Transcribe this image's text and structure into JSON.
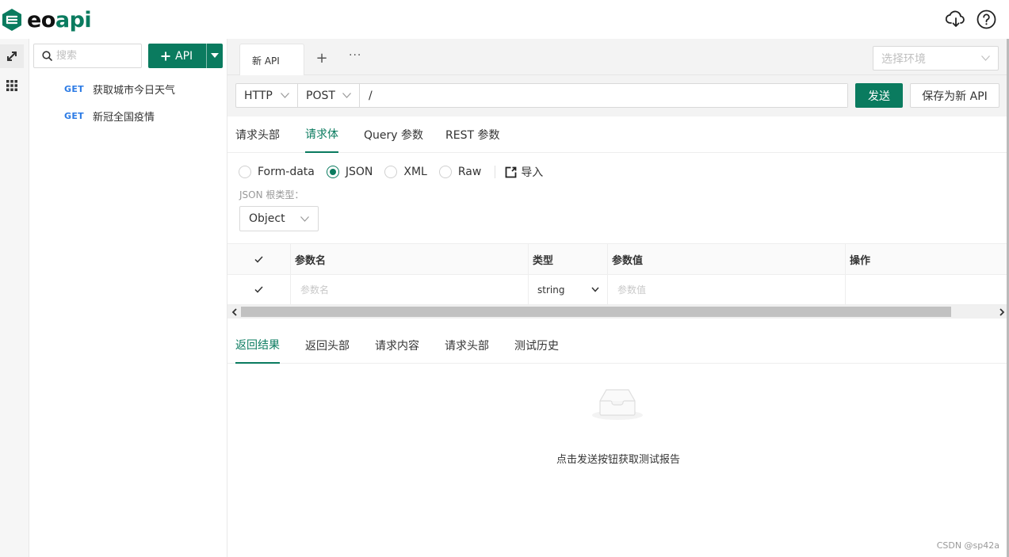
{
  "app": {
    "logo_text_prefix": "eo",
    "logo_text_suffix": "api"
  },
  "header": {
    "icons": [
      "cloud-download-icon",
      "help-icon"
    ]
  },
  "rail": {
    "items": [
      "api-icon",
      "apps-grid-icon"
    ]
  },
  "sidebar": {
    "search_placeholder": "搜索",
    "add_api_label": "API",
    "items": [
      {
        "method": "GET",
        "name": "获取城市今日天气"
      },
      {
        "method": "GET",
        "name": "新冠全国疫情"
      }
    ]
  },
  "tabs": {
    "active_label": "新 API",
    "add_label": "+",
    "more_label": "···",
    "env_placeholder": "选择环境"
  },
  "request": {
    "protocol": "HTTP",
    "method": "POST",
    "url": "/",
    "send_label": "发送",
    "save_label": "保存为新 API"
  },
  "request_tabs": [
    {
      "label": "请求头部",
      "active": false
    },
    {
      "label": "请求体",
      "active": true
    },
    {
      "label": "Query 参数",
      "active": false
    },
    {
      "label": "REST 参数",
      "active": false
    }
  ],
  "body_types": [
    {
      "label": "Form-data",
      "checked": false
    },
    {
      "label": "JSON",
      "checked": true
    },
    {
      "label": "XML",
      "checked": false
    },
    {
      "label": "Raw",
      "checked": false
    }
  ],
  "import_label": "导入",
  "json_root": {
    "label": "JSON 根类型：",
    "value": "Object"
  },
  "param_table": {
    "headers": [
      "参数名",
      "类型",
      "参数值",
      "操作"
    ],
    "rows": [
      {
        "checked": true,
        "name_placeholder": "参数名",
        "type": "string",
        "value_placeholder": "参数值"
      }
    ]
  },
  "response_tabs": [
    {
      "label": "返回结果",
      "active": true
    },
    {
      "label": "返回头部",
      "active": false
    },
    {
      "label": "请求内容",
      "active": false
    },
    {
      "label": "请求头部",
      "active": false
    },
    {
      "label": "测试历史",
      "active": false
    }
  ],
  "empty_message": "点击发送按钮获取测试报告",
  "watermark": "CSDN @sp42a",
  "colors": {
    "brand": "#0a7b5f",
    "method_get": "#2c7be5"
  }
}
